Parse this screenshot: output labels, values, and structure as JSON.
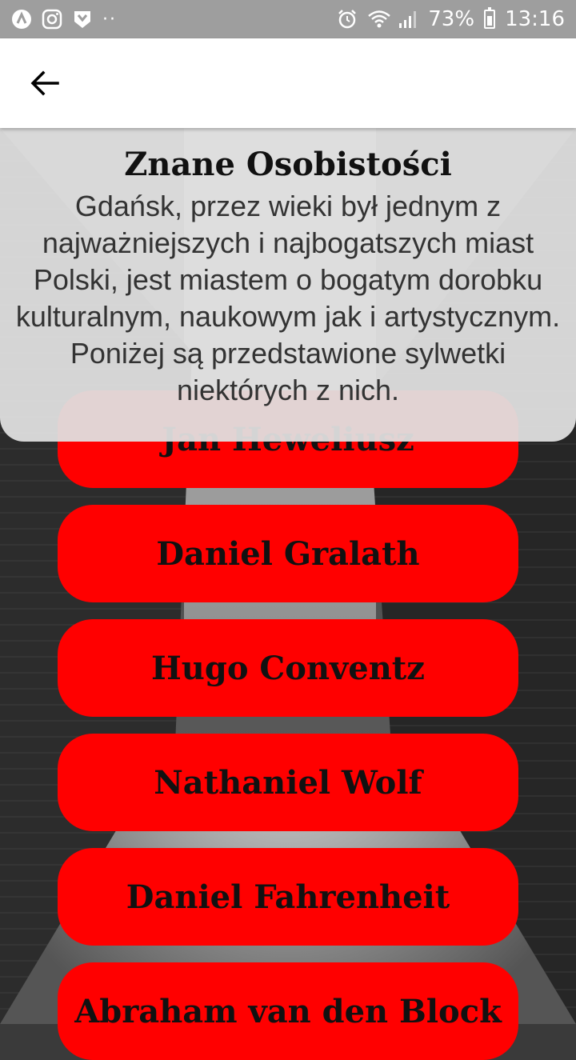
{
  "status_bar": {
    "battery": "73%",
    "time": "13:16",
    "dots": "··"
  },
  "header": {
    "title": "Znane Osobistości",
    "description": "Gdańsk, przez wieki był jednym z najważniejszych i najbogatszych miast Polski, jest miastem o bogatym dorobku kulturalnym, naukowym jak i artystycznym. Poniżej są przedstawione sylwetki niektórych z nich."
  },
  "people": [
    {
      "name": "Jan Heweliusz"
    },
    {
      "name": "Daniel Gralath"
    },
    {
      "name": "Hugo Conventz"
    },
    {
      "name": "Nathaniel Wolf"
    },
    {
      "name": "Daniel Fahrenheit"
    },
    {
      "name": "Abraham van den Block"
    }
  ],
  "colors": {
    "button": "#ff0000",
    "status_bar": "#9e9e9e",
    "card": "#e0e0e0"
  }
}
